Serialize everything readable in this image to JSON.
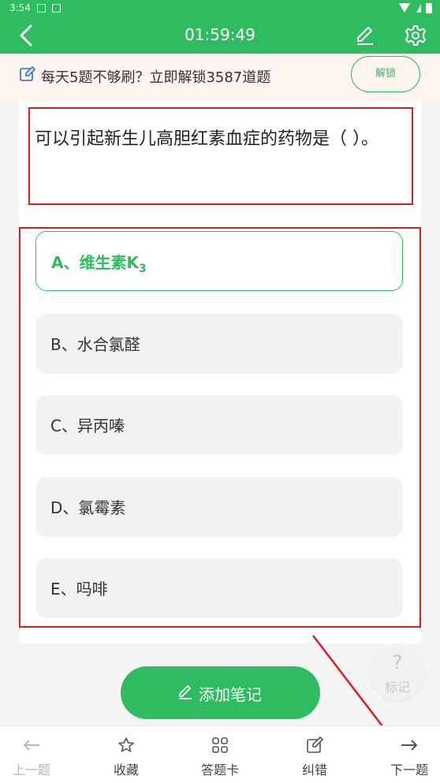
{
  "status_bar": {
    "time": "3:54"
  },
  "header": {
    "timer": "01:59:49"
  },
  "promo": {
    "text": "每天5题不够刷？立即解锁3587道题",
    "button_label": "解锁"
  },
  "question": {
    "text": "可以引起新生儿高胆红素血症的药物是（ ）。"
  },
  "options": [
    {
      "text": "A、维生素K",
      "subscript": "3",
      "selected": true
    },
    {
      "text": "B、水合氯醛",
      "selected": false
    },
    {
      "text": "C、异丙嗪",
      "selected": false
    },
    {
      "text": "D、氯霉素",
      "selected": false
    },
    {
      "text": "E、吗啡",
      "selected": false
    }
  ],
  "mark_button": {
    "icon": "?",
    "label": "标记"
  },
  "add_note": {
    "label": "添加笔记"
  },
  "bottom_nav": [
    {
      "label": "上一题",
      "icon": "arrow-left-icon",
      "enabled": false
    },
    {
      "label": "收藏",
      "icon": "star-icon",
      "enabled": true
    },
    {
      "label": "答题卡",
      "icon": "grid-icon",
      "enabled": true
    },
    {
      "label": "纠错",
      "icon": "edit-icon",
      "enabled": true
    },
    {
      "label": "下一题",
      "icon": "arrow-right-icon",
      "enabled": true
    }
  ],
  "colors": {
    "primary": "#2fbb5f",
    "annotation": "#d81e1e",
    "promo_bg": "#fdf3ef"
  }
}
